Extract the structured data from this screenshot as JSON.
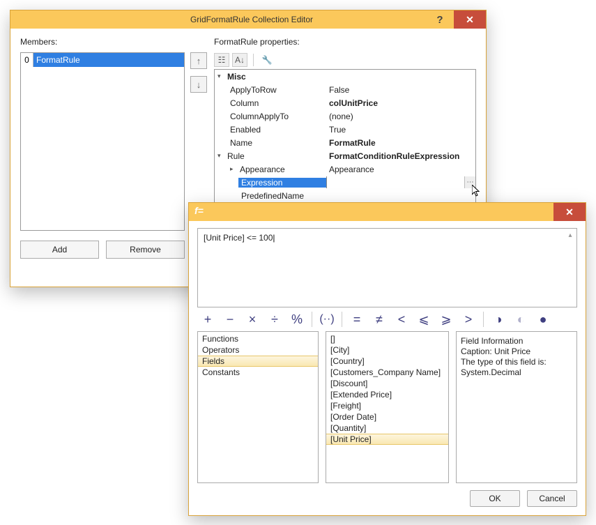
{
  "collectionEditor": {
    "title": "GridFormatRule Collection Editor",
    "help": "?",
    "close": "✕",
    "membersLabel": "Members:",
    "members": [
      {
        "index": "0",
        "name": "FormatRule"
      }
    ],
    "upArrow": "↑",
    "downArrow": "↓",
    "addLabel": "Add",
    "removeLabel": "Remove",
    "propertiesLabel": "FormatRule properties:",
    "toolCategorized": "☷",
    "toolAlpha": "A↓",
    "toolPages": "🔧",
    "grid": {
      "miscLabel": "Misc",
      "rows": [
        {
          "name": "ApplyToRow",
          "value": "False"
        },
        {
          "name": "Column",
          "value": "colUnitPrice",
          "bold": true
        },
        {
          "name": "ColumnApplyTo",
          "value": "(none)"
        },
        {
          "name": "Enabled",
          "value": "True"
        },
        {
          "name": "Name",
          "value": "FormatRule",
          "bold": true
        },
        {
          "name": "Rule",
          "value": "FormatConditionRuleExpression",
          "bold": true
        }
      ],
      "appearanceLabel": "Appearance",
      "appearanceValue": "Appearance",
      "expressionLabel": "Expression",
      "expressionValue": "",
      "expressionDropdown": "⋯",
      "predefLabel": "PredefinedName"
    }
  },
  "exprEditor": {
    "fx": "f=",
    "close": "✕",
    "expression": "[Unit Price] <= 100",
    "ops": {
      "plus": "+",
      "minus": "−",
      "mult": "×",
      "div": "÷",
      "pct": "%",
      "paren": "(··)",
      "eq": "=",
      "neq": "≠",
      "lt": "<",
      "le": "⩽",
      "ge": "⩾",
      "gt": ">",
      "and": "◑",
      "or": "◐",
      "not": "●"
    },
    "categories": [
      "Functions",
      "Operators",
      "Fields",
      "Constants"
    ],
    "selectedCategory": "Fields",
    "fields": [
      "[]",
      "[City]",
      "[Country]",
      "[Customers_Company Name]",
      "[Discount]",
      "[Extended Price]",
      "[Freight]",
      "[Order Date]",
      "[Quantity]",
      "[Unit Price]"
    ],
    "selectedField": "[Unit Price]",
    "info": {
      "l1": "Field Information",
      "l2": "Caption: Unit Price",
      "l3": "The type of this field is:",
      "l4": "System.Decimal"
    },
    "ok": "OK",
    "cancel": "Cancel"
  }
}
